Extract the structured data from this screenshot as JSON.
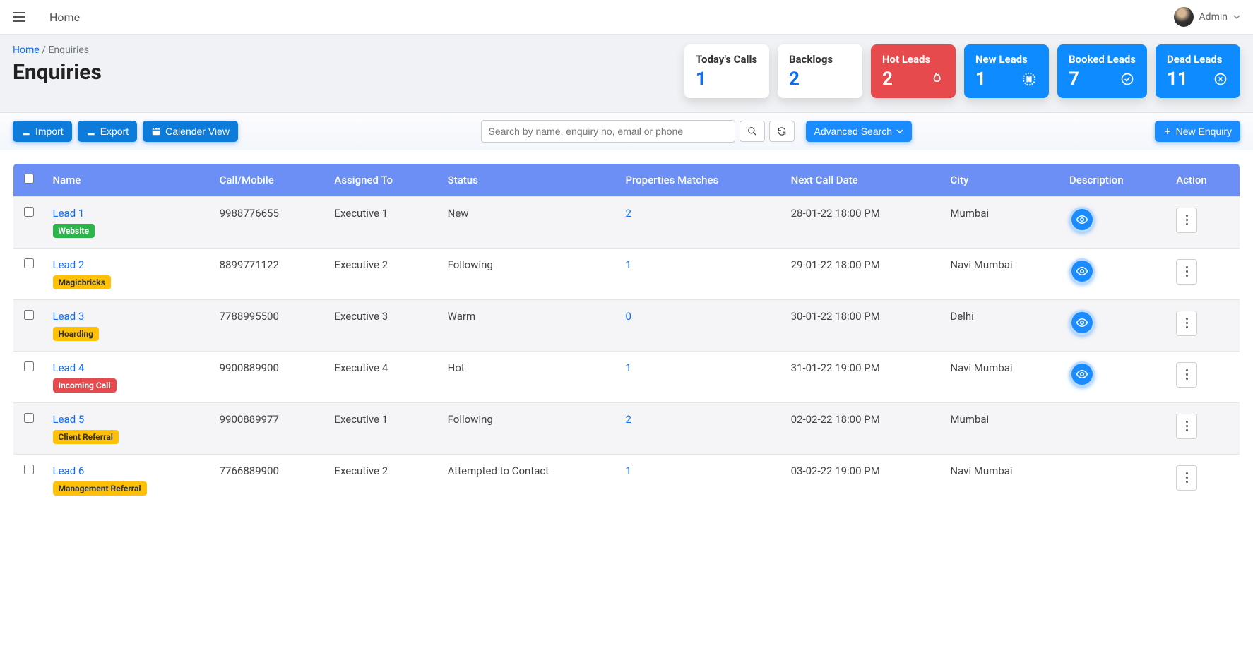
{
  "topbar": {
    "home": "Home",
    "user": "Admin"
  },
  "breadcrumb": {
    "home": "Home",
    "sep": "/",
    "current": "Enquiries"
  },
  "page_title": "Enquiries",
  "stats": {
    "todays_calls": {
      "title": "Today's Calls",
      "count": "1"
    },
    "backlogs": {
      "title": "Backlogs",
      "count": "2"
    },
    "hot_leads": {
      "title": "Hot Leads",
      "count": "2"
    },
    "new_leads": {
      "title": "New Leads",
      "count": "1"
    },
    "booked_leads": {
      "title": "Booked Leads",
      "count": "7"
    },
    "dead_leads": {
      "title": "Dead Leads",
      "count": "11"
    }
  },
  "toolbar": {
    "import": "Import",
    "export": "Export",
    "calendar": "Calender View",
    "search_placeholder": "Search by name, enquiry no, email or phone",
    "advanced": "Advanced Search",
    "new_enquiry": "New Enquiry"
  },
  "columns": {
    "name": "Name",
    "mobile": "Call/Mobile",
    "assigned": "Assigned To",
    "status": "Status",
    "properties": "Properties Matches",
    "next_call": "Next Call Date",
    "city": "City",
    "description": "Description",
    "action": "Action"
  },
  "rows": [
    {
      "name": "Lead 1",
      "source": "Website",
      "source_class": "green",
      "mobile": "9988776655",
      "assigned": "Executive 1",
      "status": "New",
      "matches": "2",
      "next_call": "28-01-22 18:00 PM",
      "city": "Mumbai",
      "has_eye": true
    },
    {
      "name": "Lead 2",
      "source": "Magicbricks",
      "source_class": "yellow",
      "mobile": "8899771122",
      "assigned": "Executive 2",
      "status": "Following",
      "matches": "1",
      "next_call": "29-01-22 18:00 PM",
      "city": "Navi Mumbai",
      "has_eye": true
    },
    {
      "name": "Lead 3",
      "source": "Hoarding",
      "source_class": "yellow",
      "mobile": "7788995500",
      "assigned": "Executive 3",
      "status": "Warm",
      "matches": "0",
      "next_call": "30-01-22 18:00 PM",
      "city": "Delhi",
      "has_eye": true
    },
    {
      "name": "Lead 4",
      "source": "Incoming Call",
      "source_class": "redb",
      "mobile": "9900889900",
      "assigned": "Executive 4",
      "status": "Hot",
      "matches": "1",
      "next_call": "31-01-22 19:00 PM",
      "city": "Navi Mumbai",
      "has_eye": true
    },
    {
      "name": "Lead 5",
      "source": "Client Referral",
      "source_class": "yellow",
      "mobile": "9900889977",
      "assigned": "Executive 1",
      "status": "Following",
      "matches": "2",
      "next_call": "02-02-22 18:00 PM",
      "city": "Mumbai",
      "has_eye": false
    },
    {
      "name": "Lead 6",
      "source": "Management Referral",
      "source_class": "yellow",
      "mobile": "7766889900",
      "assigned": "Executive 2",
      "status": "Attempted to Contact",
      "matches": "1",
      "next_call": "03-02-22 19:00 PM",
      "city": "Navi Mumbai",
      "has_eye": false
    }
  ]
}
